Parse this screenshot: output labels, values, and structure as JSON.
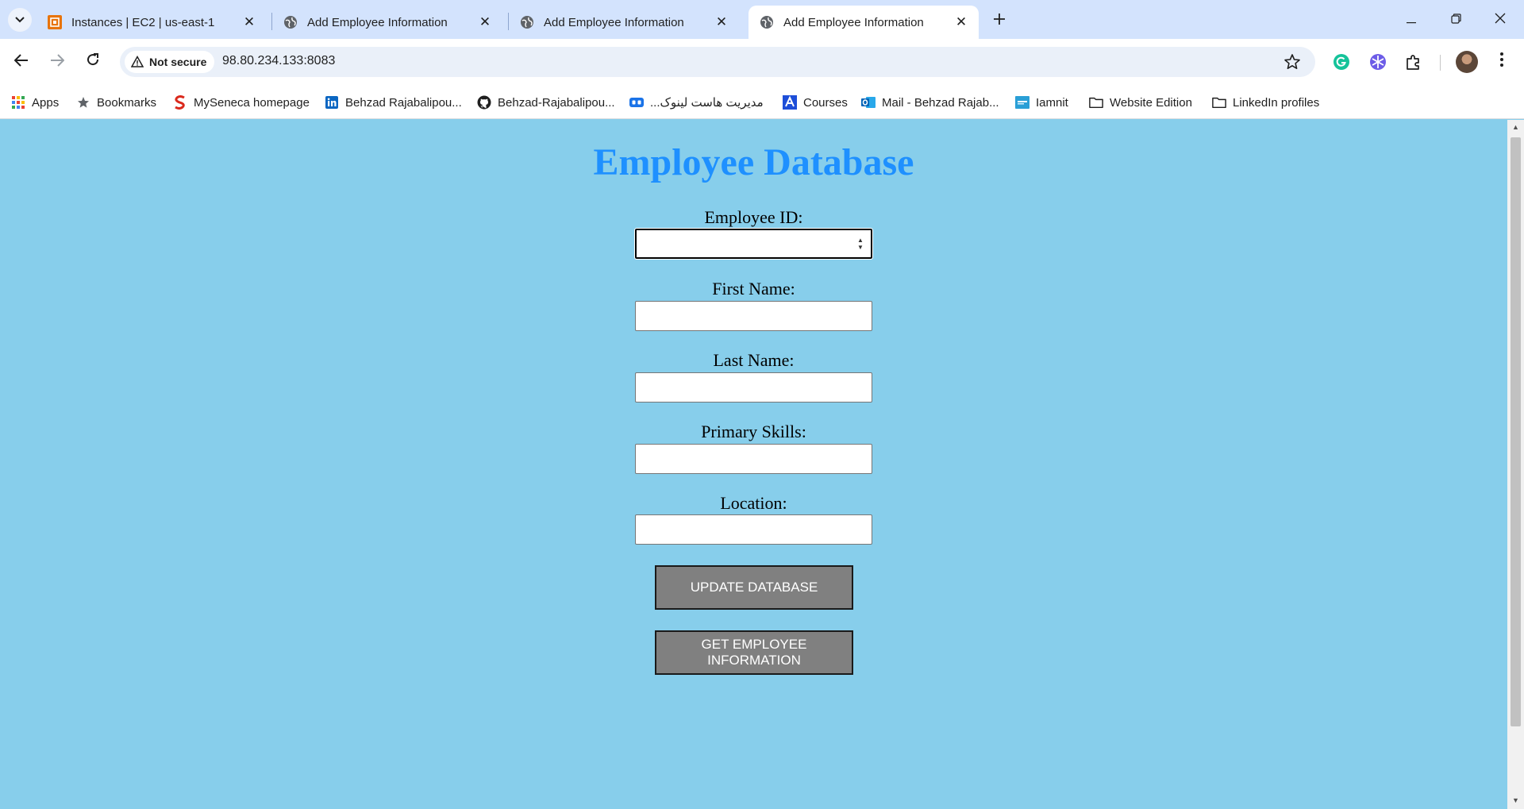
{
  "browser": {
    "tabs": [
      {
        "title": "Instances | EC2 | us-east-1",
        "favicon": "aws-ec2-icon",
        "active": false
      },
      {
        "title": "Add Employee Information",
        "favicon": "globe-icon",
        "active": false
      },
      {
        "title": "Add Employee Information",
        "favicon": "globe-icon",
        "active": false
      },
      {
        "title": "Add Employee Information",
        "favicon": "globe-icon",
        "active": true
      }
    ],
    "security_label": "Not secure",
    "url": "98.80.234.133:8083",
    "bookmarks": [
      {
        "label": "Apps",
        "icon": "apps-grid-icon"
      },
      {
        "label": "Bookmarks",
        "icon": "star-icon"
      },
      {
        "label": "MySeneca homepage",
        "icon": "seneca-icon"
      },
      {
        "label": "Behzad Rajabalipou...",
        "icon": "linkedin-icon"
      },
      {
        "label": "Behzad-Rajabalipou...",
        "icon": "github-icon"
      },
      {
        "label": "مدیریت هاست لینوک...",
        "icon": "hosting-icon"
      },
      {
        "label": "Courses",
        "icon": "courses-icon"
      },
      {
        "label": "Mail - Behzad Rajab...",
        "icon": "outlook-icon"
      },
      {
        "label": "Iamnit",
        "icon": "iamnit-icon"
      },
      {
        "label": "Website Edition",
        "icon": "folder-icon"
      },
      {
        "label": "LinkedIn profiles",
        "icon": "folder-icon"
      }
    ]
  },
  "page": {
    "title": "Employee Database",
    "fields": {
      "employee_id": {
        "label": "Employee ID:",
        "value": ""
      },
      "first_name": {
        "label": "First Name:",
        "value": ""
      },
      "last_name": {
        "label": "Last Name:",
        "value": ""
      },
      "primary_skills": {
        "label": "Primary Skills:",
        "value": ""
      },
      "location": {
        "label": "Location:",
        "value": ""
      }
    },
    "buttons": {
      "update": "UPDATE DATABASE",
      "get_info": "GET EMPLOYEE INFORMATION"
    }
  },
  "colors": {
    "page_background": "#87ceeb",
    "title": "#1e90ff",
    "button_background": "#808080"
  }
}
